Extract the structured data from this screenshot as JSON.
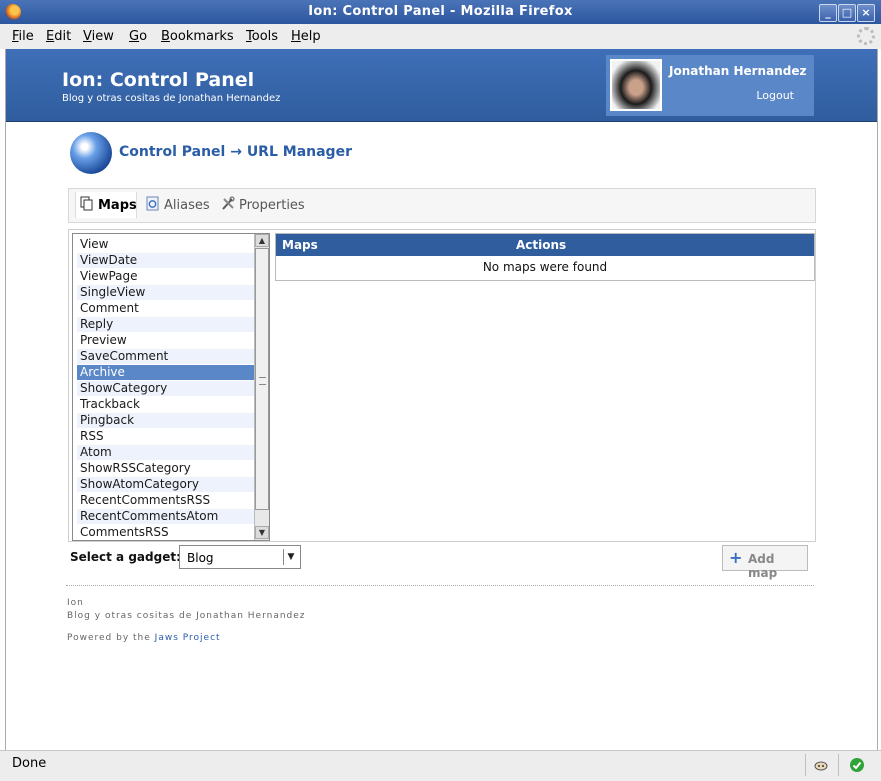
{
  "window": {
    "title": "Ion: Control Panel - Mozilla Firefox"
  },
  "menu": [
    "File",
    "Edit",
    "View",
    "Go",
    "Bookmarks",
    "Tools",
    "Help"
  ],
  "header": {
    "site_title": "Ion: Control Panel",
    "site_subtitle": "Blog y otras cositas de Jonathan Hernandez",
    "user_name": "Jonathan Hernandez",
    "logout": "Logout"
  },
  "breadcrumb": "Control Panel → URL Manager",
  "tabs": [
    {
      "label": "Maps",
      "icon": "maps-icon",
      "active": true
    },
    {
      "label": "Aliases",
      "icon": "aliases-icon",
      "active": false
    },
    {
      "label": "Properties",
      "icon": "properties-icon",
      "active": false
    }
  ],
  "actions": {
    "items": [
      "View",
      "ViewDate",
      "ViewPage",
      "SingleView",
      "Comment",
      "Reply",
      "Preview",
      "SaveComment",
      "Archive",
      "ShowCategory",
      "Trackback",
      "Pingback",
      "RSS",
      "Atom",
      "ShowRSSCategory",
      "ShowAtomCategory",
      "RecentCommentsRSS",
      "RecentCommentsAtom",
      "CommentsRSS"
    ],
    "selected": "Archive"
  },
  "maps_grid": {
    "columns": [
      "Maps",
      "Actions"
    ],
    "empty_message": "No maps were found"
  },
  "gadget": {
    "label": "Select a gadget:",
    "value": "Blog"
  },
  "add_map": "Add map",
  "footer": {
    "site_name": "Ion",
    "site_slogan": "Blog y otras cositas de Jonathan Hernandez",
    "powered_prefix": "Powered by the",
    "powered_link": "Jaws Project"
  },
  "status": {
    "text": "Done"
  },
  "colors": {
    "header": "#2f5d9e",
    "accent": "#5a87c7",
    "link": "#2a5da8"
  }
}
